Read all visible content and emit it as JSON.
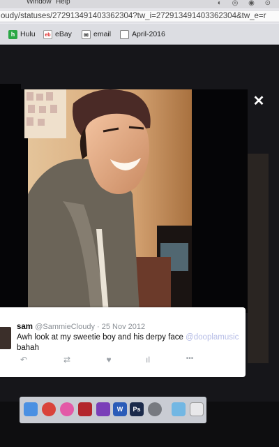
{
  "menubar": {
    "items": [
      "Window",
      "Help"
    ]
  },
  "address": {
    "url": "oudy/statuses/272913491403362304?tw_i=272913491403362304&tw_e=r"
  },
  "bookmarks": [
    {
      "label": "Hulu",
      "icon": "hulu-icon",
      "glyph": "h"
    },
    {
      "label": "eBay",
      "icon": "ebay-icon",
      "glyph": "eb"
    },
    {
      "label": "email",
      "icon": "email-icon",
      "glyph": "✉"
    },
    {
      "label": "April-2016",
      "icon": "page-icon",
      "glyph": ""
    }
  ],
  "lightbox": {
    "close_glyph": "✕"
  },
  "tweet": {
    "name": "sam",
    "handle": "@SammieCloudy",
    "separator": " · ",
    "date": "25 Nov 2012",
    "text": "Awh look at my sweetie boy and his derpy face",
    "mention": "@dooplamusic",
    "text_end": "bahah",
    "actions": [
      {
        "name": "reply-icon",
        "glyph": "↶"
      },
      {
        "name": "retweet-icon",
        "glyph": "⇄"
      },
      {
        "name": "like-icon",
        "glyph": "♥"
      },
      {
        "name": "analytics-icon",
        "glyph": "ıl"
      },
      {
        "name": "more-icon",
        "glyph": "•••"
      }
    ]
  },
  "dock": [
    {
      "name": "finder-icon",
      "color": "#4a90e2"
    },
    {
      "name": "chrome-icon",
      "color": "#d9433a"
    },
    {
      "name": "itunes-icon",
      "color": "#e35aa7"
    },
    {
      "name": "photobooth-icon",
      "color": "#b3262c"
    },
    {
      "name": "imovie-icon",
      "color": "#7a3fb8"
    },
    {
      "name": "word-icon",
      "color": "#2b5cb8",
      "glyph": "W"
    },
    {
      "name": "photoshop-icon",
      "color": "#1b2a4a",
      "glyph": "Ps"
    },
    {
      "name": "system-preferences-icon",
      "color": "#777a80"
    },
    {
      "name": "downloads-folder-icon",
      "color": "#72b7e3"
    },
    {
      "name": "trash-icon",
      "color": "#e8e8ea"
    }
  ]
}
